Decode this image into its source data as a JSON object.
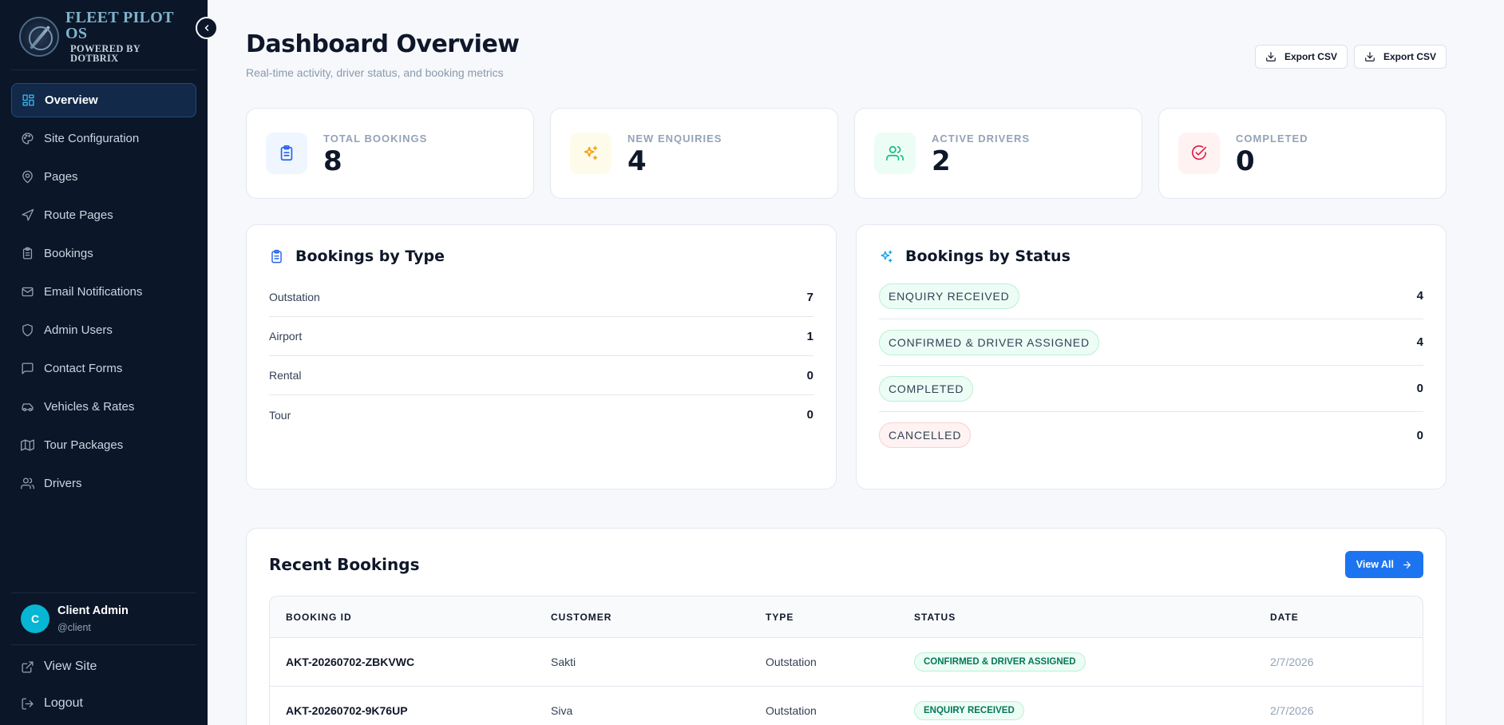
{
  "brand": {
    "title": "FLEET PILOT OS",
    "subtitle": "POWERED BY DOTBRIX"
  },
  "sidebar": {
    "items": [
      {
        "label": "Overview",
        "icon": "grid-icon",
        "active": true
      },
      {
        "label": "Site Configuration",
        "icon": "palette-icon"
      },
      {
        "label": "Pages",
        "icon": "map-pin-icon"
      },
      {
        "label": "Route Pages",
        "icon": "navigation-icon"
      },
      {
        "label": "Bookings",
        "icon": "clipboard-icon"
      },
      {
        "label": "Email Notifications",
        "icon": "mail-icon"
      },
      {
        "label": "Admin Users",
        "icon": "shield-icon"
      },
      {
        "label": "Contact Forms",
        "icon": "message-icon"
      },
      {
        "label": "Vehicles & Rates",
        "icon": "car-icon"
      },
      {
        "label": "Tour Packages",
        "icon": "map-icon"
      },
      {
        "label": "Drivers",
        "icon": "users-icon"
      }
    ],
    "user": {
      "initial": "C",
      "name": "Client Admin",
      "handle": "@client"
    },
    "view_site": "View Site",
    "logout": "Logout"
  },
  "header": {
    "title": "Dashboard Overview",
    "subtitle": "Real-time activity, driver status, and booking metrics",
    "export_1": "Export CSV",
    "export_2": "Export CSV"
  },
  "stats": [
    {
      "label": "TOTAL BOOKINGS",
      "value": "8",
      "color": "#2563eb",
      "bg": "#eff6ff"
    },
    {
      "label": "NEW ENQUIRIES",
      "value": "4",
      "color": "#f59e0b",
      "bg": "#fffbeb"
    },
    {
      "label": "ACTIVE DRIVERS",
      "value": "2",
      "color": "#10b981",
      "bg": "#ecfdf5"
    },
    {
      "label": "COMPLETED",
      "value": "0",
      "color": "#e11d48",
      "bg": "#fef2f2"
    }
  ],
  "bookings_by_type": {
    "title": "Bookings by Type",
    "rows": [
      {
        "label": "Outstation",
        "value": "7"
      },
      {
        "label": "Airport",
        "value": "1"
      },
      {
        "label": "Rental",
        "value": "0"
      },
      {
        "label": "Tour",
        "value": "0"
      }
    ]
  },
  "bookings_by_status": {
    "title": "Bookings by Status",
    "rows": [
      {
        "label": "ENQUIRY RECEIVED",
        "value": "4"
      },
      {
        "label": "CONFIRMED & DRIVER ASSIGNED",
        "value": "4"
      },
      {
        "label": "COMPLETED",
        "value": "0"
      },
      {
        "label": "CANCELLED",
        "value": "0"
      }
    ]
  },
  "recent": {
    "title": "Recent Bookings",
    "view_all": "View All",
    "columns": [
      "BOOKING ID",
      "CUSTOMER",
      "TYPE",
      "STATUS",
      "DATE"
    ],
    "rows": [
      {
        "id": "AKT-20260702-ZBKVWC",
        "customer": "Sakti",
        "type": "Outstation",
        "status": "CONFIRMED & DRIVER ASSIGNED",
        "date": "2/7/2026"
      },
      {
        "id": "AKT-20260702-9K76UP",
        "customer": "Siva",
        "type": "Outstation",
        "status": "ENQUIRY RECEIVED",
        "date": "2/7/2026"
      }
    ]
  }
}
